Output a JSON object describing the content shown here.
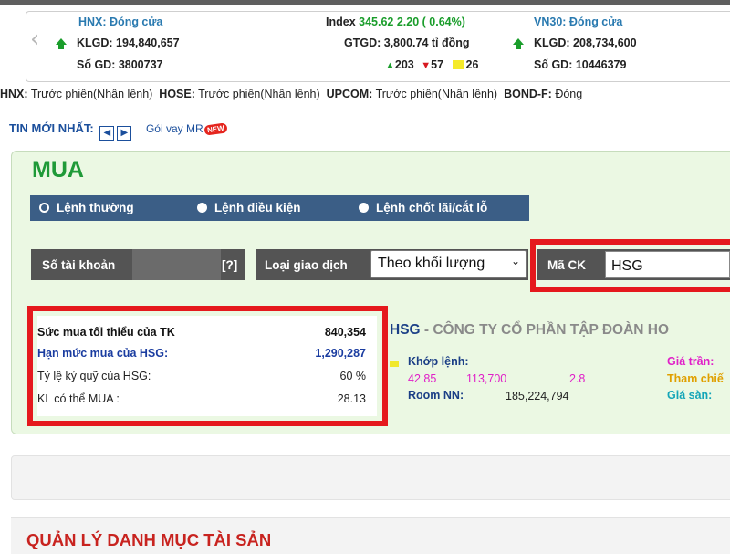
{
  "ticker": {
    "hnx_status": "HNX: Đóng cửa",
    "hnx_klgd": "KLGD:  194,840,657",
    "hnx_sogd": "Số GD:  3800737",
    "index_label": "Index",
    "index_value": "345.62  2.20 ( 0.64%)",
    "gtgd": "GTGD:  3,800.74 tỉ đồng",
    "advances": "203",
    "declines": "57",
    "unchanged": "26",
    "vn30_status": "VN30: Đóng cửa",
    "vn30_klgd": "KLGD:  208,734,600",
    "vn30_sogd": "Số GD:  10446379"
  },
  "sessions": [
    {
      "exchange": "HNX:",
      "status": "Trước phiên(Nhận lệnh)"
    },
    {
      "exchange": "HOSE:",
      "status": "Trước phiên(Nhận lệnh)"
    },
    {
      "exchange": "UPCOM:",
      "status": "Trước phiên(Nhận lệnh)"
    },
    {
      "exchange": "BOND-F:",
      "status": "Đóng"
    }
  ],
  "news": {
    "title": "TIN MỚI NHẤT:",
    "prev": "◀",
    "next": "▶",
    "link": "Gói vay MR",
    "badge": "NEW"
  },
  "order": {
    "title": "MUA",
    "types": [
      "Lệnh thường",
      "Lệnh điều kiện",
      "Lệnh chốt lãi/cắt lỗ"
    ],
    "selected_type": "Lệnh thường",
    "account_label": "Số tài khoản",
    "help": "[?]",
    "trade_type_label": "Loại giao dịch",
    "trade_type_value": "Theo khối lượng",
    "code_label": "Mã CK",
    "code_value": "HSG"
  },
  "stats": [
    {
      "label": "Sức mua tối thiểu của TK",
      "value": "840,354"
    },
    {
      "label": "Hạn mức mua của HSG:",
      "value": "1,290,287"
    },
    {
      "label": "Tỷ lệ ký quỹ của HSG:",
      "value": "60 %"
    },
    {
      "label": "KL có thể MUA :",
      "value": "28.13"
    }
  ],
  "company": {
    "code": "HSG",
    "name": " - CÔNG TY CỔ PHẦN TẬP ĐOÀN HO",
    "match_label": "Khớp lệnh:",
    "match_price": "42.85",
    "match_volume": "113,700",
    "match_change": "2.8",
    "room_label": "Room NN:",
    "room_value": "185,224,794",
    "ceiling_label": "Giá trần:",
    "reference_label": "Tham chiế",
    "floor_label": "Giá sàn:"
  },
  "portfolio": {
    "title": "QUẢN LÝ DANH MỤC TÀI SẢN"
  },
  "colors": {
    "panel_bg": "#ebf8e3",
    "mua_green": "#1f9a38",
    "order_bar": "#3b5e86",
    "highlight_red": "#e5191d",
    "magenta": "#e020c8",
    "gold": "#e0a000",
    "cyan": "#14a5b8"
  }
}
